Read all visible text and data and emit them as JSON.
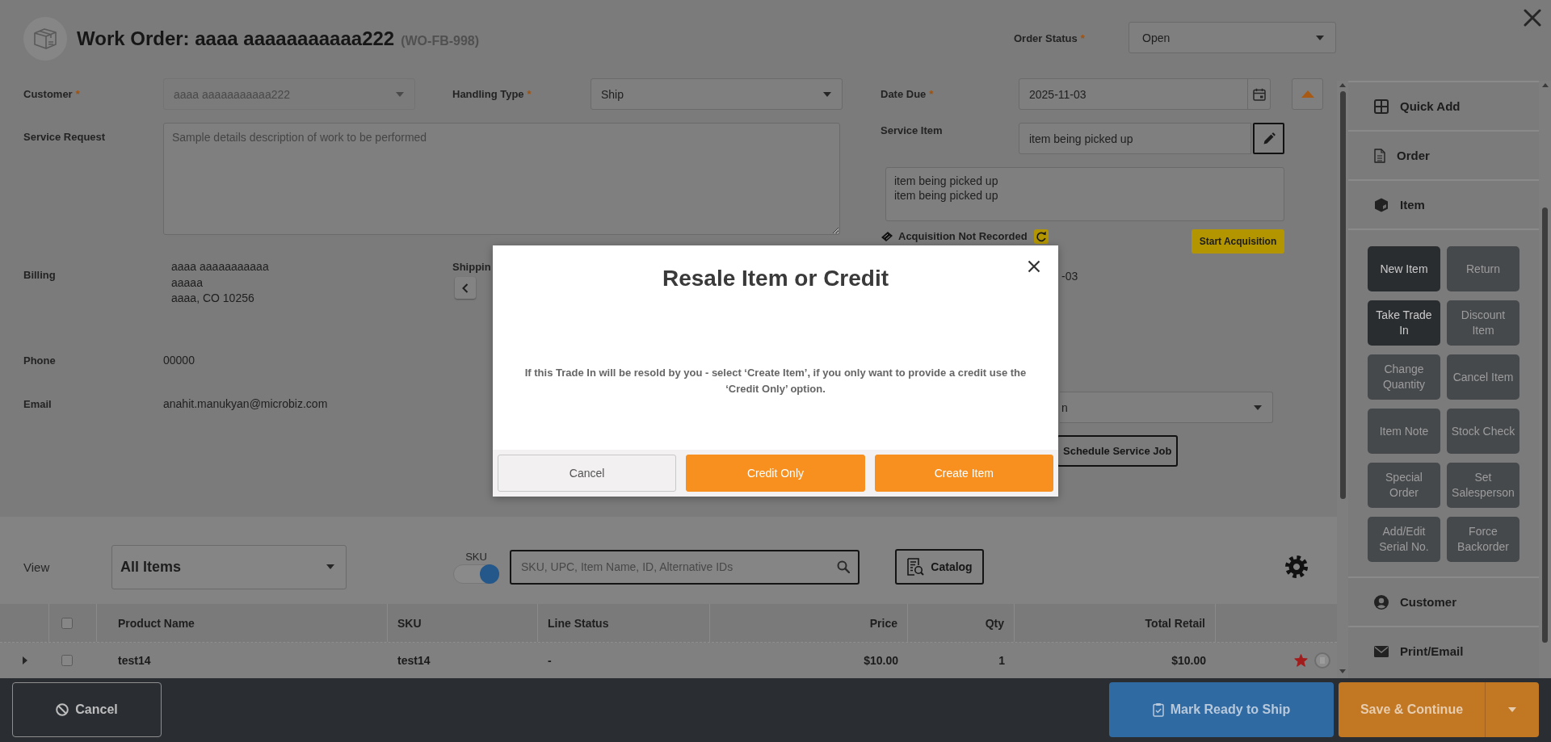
{
  "header": {
    "title": "Work Order: aaaa aaaaaaaaaaa222",
    "order_number": "(WO-FB-998)",
    "order_status": {
      "label": "Order Status",
      "required_mark": "*",
      "value": "Open"
    }
  },
  "form": {
    "customer": {
      "label": "Customer",
      "required_mark": "*",
      "value": "aaaa aaaaaaaaaaa222",
      "disabled": true
    },
    "handling_type": {
      "label": "Handling Type",
      "required_mark": "*",
      "value": "Ship",
      "disabled": false
    },
    "service_request": {
      "label": "Service Request",
      "placeholder": "Sample details description of work to be performed"
    },
    "billing": {
      "label": "Billing",
      "lines": [
        "aaaa aaaaaaaaaaa",
        "aaaaa",
        "aaaa, CO 10256"
      ]
    },
    "shipping": {
      "label": "Shippin"
    },
    "phone": {
      "label": "Phone",
      "value": "00000"
    },
    "email": {
      "label": "Email",
      "value": "anahit.manukyan@microbiz.com"
    },
    "date_due": {
      "label": "Date Due",
      "required_mark": "*",
      "value": "2025-11-03"
    },
    "service_item": {
      "label": "Service Item",
      "value": "item being picked up",
      "description": [
        "item being picked up",
        "item being picked up"
      ]
    },
    "acquisition": {
      "status": "Acquisition Not Recorded",
      "button": "Start Acquisition"
    },
    "partial_value": "-03",
    "partial_dropdown": {
      "value": "n"
    },
    "schedule_button": "Schedule Service Job"
  },
  "items": {
    "view": {
      "label": "View",
      "value": "All Items"
    },
    "sku_toggle": {
      "label": "SKU",
      "on": true
    },
    "search": {
      "placeholder": "SKU, UPC, Item Name, ID, Alternative IDs"
    },
    "catalog_button": "Catalog",
    "table": {
      "select_all": {
        "checked": false
      },
      "columns": [
        {
          "label": "Product Name",
          "kind": "text"
        },
        {
          "label": "SKU",
          "kind": "text"
        },
        {
          "label": "Line Status",
          "kind": "text"
        },
        {
          "label": "Price",
          "kind": "number"
        },
        {
          "label": "Qty",
          "kind": "number"
        },
        {
          "label": "Total Retail",
          "kind": "number"
        }
      ],
      "rows": [
        {
          "expanded": false,
          "checked": false,
          "cells": [
            "test14",
            "test14",
            "-",
            "$10.00",
            "1",
            "$10.00"
          ],
          "flagged": true
        }
      ]
    }
  },
  "sidebar": {
    "sections": [
      {
        "label": "Quick Add"
      },
      {
        "label": "Order"
      },
      {
        "label": "Item",
        "buttons": [
          {
            "label": "New Item",
            "disabled": false
          },
          {
            "label": "Return",
            "disabled": true
          },
          {
            "label": "Take Trade In",
            "disabled": false
          },
          {
            "label": "Discount Item",
            "disabled": true
          },
          {
            "label": "Change Quantity",
            "disabled": true
          },
          {
            "label": "Cancel Item",
            "disabled": true
          },
          {
            "label": "Item Note",
            "disabled": true
          },
          {
            "label": "Stock Check",
            "disabled": true
          },
          {
            "label": "Special Order",
            "disabled": true
          },
          {
            "label": "Set Salesperson",
            "disabled": true
          },
          {
            "label": "Add/Edit Serial No.",
            "disabled": true
          },
          {
            "label": "Force Backorder",
            "disabled": true
          }
        ]
      },
      {
        "label": "Customer"
      },
      {
        "label": "Print/Email"
      }
    ]
  },
  "footer": {
    "buttons": [
      {
        "label": "Cancel",
        "kind": "outline"
      },
      {
        "label": "Mark Ready to Ship",
        "kind": "info"
      },
      {
        "label": "Save & Continue",
        "kind": "split"
      }
    ]
  },
  "modal": {
    "title": "Resale Item or Credit",
    "message": "If this Trade In will be resold by you - select ‘Create Item’, if you only want to provide a credit use the ‘Credit Only’ option.",
    "buttons": [
      {
        "label": "Cancel",
        "kind": "secondary"
      },
      {
        "label": "Credit Only",
        "kind": "primary"
      },
      {
        "label": "Create Item",
        "kind": "primary"
      }
    ]
  }
}
